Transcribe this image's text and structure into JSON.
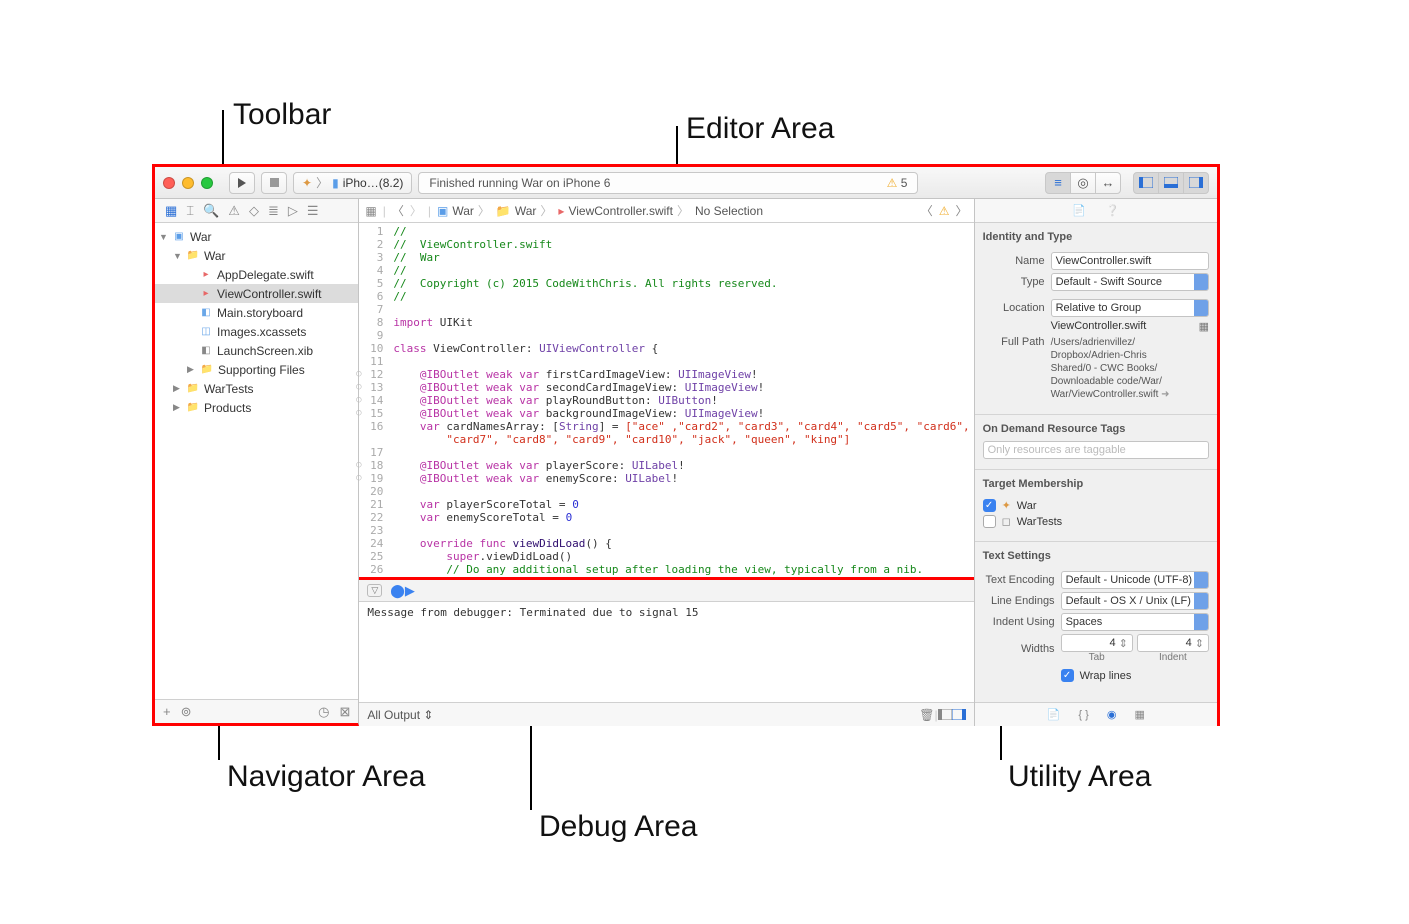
{
  "annotations": {
    "toolbar": "Toolbar",
    "editor": "Editor Area",
    "navigator": "Navigator Area",
    "debug": "Debug Area",
    "utility": "Utility Area"
  },
  "toolbar": {
    "scheme_app": "War",
    "scheme_device": "iPho…(8.2)",
    "status_text": "Finished running War on iPhone 6",
    "warn_count": "5"
  },
  "jump_bar": {
    "p1": "War",
    "p2": "War",
    "p3": "ViewController.swift",
    "p4": "No Selection"
  },
  "navigator": {
    "root": "War",
    "group": "War",
    "files": {
      "appdelegate": "AppDelegate.swift",
      "viewcontroller": "ViewController.swift",
      "storyboard": "Main.storyboard",
      "assets": "Images.xcassets",
      "launch": "LaunchScreen.xib",
      "supporting": "Supporting Files"
    },
    "tests": "WarTests",
    "products": "Products"
  },
  "code": {
    "c1": "//",
    "c2": "//  ViewController.swift",
    "c3": "//  War",
    "c4": "//",
    "c5": "//  Copyright (c) 2015 CodeWithChris. All rights reserved.",
    "c6": "//",
    "l_import_kw": "import",
    "l_import_mod": "UIKit",
    "l_class_kw": "class",
    "l_class_name": "ViewController",
    "l_class_sup": "UIViewController",
    "obrace": " {",
    "ib": "@IBOutlet",
    "weak": "weak",
    "var": "var",
    "o1_n": "firstCardImageView",
    "o1_t": "UIImageView",
    "o2_n": "secondCardImageView",
    "o2_t": "UIImageView",
    "o3_n": "playRoundButton",
    "o3_t": "UIButton",
    "o4_n": "backgroundImageView",
    "o4_t": "UIImageView",
    "arr_n": "cardNamesArray",
    "arr_t": "String",
    "arr_v1": "[\"ace\" ,\"card2\", \"card3\", \"card4\", \"card5\", \"card6\",",
    "arr_v2": "\"card7\", \"card8\", \"card9\", \"card10\", \"jack\", \"queen\", \"king\"]",
    "o5_n": "playerScore",
    "o5_t": "UILabel",
    "o6_n": "enemyScore",
    "o6_t": "UILabel",
    "pst_n": "playerScoreTotal",
    "pst_v": "0",
    "est_n": "enemyScoreTotal",
    "est_v": "0",
    "override": "override",
    "funckw": "func",
    "vdl": "viewDidLoad",
    "superkw": "super",
    "vdlcall": ".viewDidLoad()",
    "nibcmt": "// Do any additional setup after loading the view, typically from a nib."
  },
  "debug": {
    "message": "Message from debugger: Terminated due to signal 15",
    "filter": "All Output"
  },
  "utility": {
    "identity_h": "Identity and Type",
    "name_l": "Name",
    "name_v": "ViewController.swift",
    "type_l": "Type",
    "type_v": "Default - Swift Source",
    "loc_l": "Location",
    "loc_v": "Relative to Group",
    "loc_file": "ViewController.swift",
    "fullpath_l": "Full Path",
    "fullpath_v": "/Users/adrienvillez/\nDropbox/Adrien-Chris\nShared/0 - CWC Books/\nDownloadable code/War/\nWar/ViewController.swift",
    "ondemand_h": "On Demand Resource Tags",
    "ondemand_ph": "Only resources are taggable",
    "target_h": "Target Membership",
    "target1": "War",
    "target2": "WarTests",
    "textset_h": "Text Settings",
    "enc_l": "Text Encoding",
    "enc_v": "Default - Unicode (UTF-8)",
    "le_l": "Line Endings",
    "le_v": "Default - OS X / Unix (LF)",
    "indent_l": "Indent Using",
    "indent_v": "Spaces",
    "widths_l": "Widths",
    "tab_v": "4",
    "tab_l": "Tab",
    "ind_v": "4",
    "ind_l": "Indent",
    "wrap": "Wrap lines"
  }
}
